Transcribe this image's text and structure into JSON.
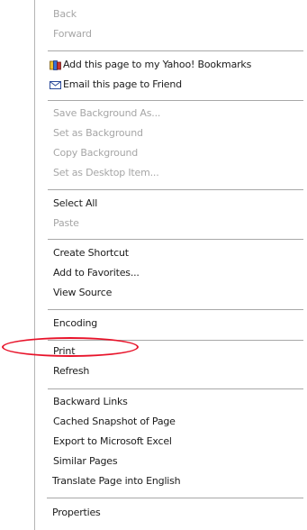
{
  "menu": {
    "items": [
      {
        "label": "Back",
        "disabled": true
      },
      {
        "label": "Forward",
        "disabled": true
      },
      {
        "label": "Add this page to my Yahoo! Bookmarks",
        "icon": "yahoo-bookmark-icon"
      },
      {
        "label": "Email this page to Friend",
        "icon": "envelope-icon"
      },
      {
        "label": "Save Background As...",
        "disabled": true
      },
      {
        "label": "Set as Background",
        "disabled": true
      },
      {
        "label": "Copy Background",
        "disabled": true
      },
      {
        "label": "Set as Desktop Item...",
        "disabled": true
      },
      {
        "label": "Select All"
      },
      {
        "label": "Paste",
        "disabled": true
      },
      {
        "label": "Create Shortcut"
      },
      {
        "label": "Add to Favorites..."
      },
      {
        "label": "View Source"
      },
      {
        "label": "Encoding",
        "submenu": true
      },
      {
        "label": "Print",
        "highlighted": true
      },
      {
        "label": "Refresh"
      },
      {
        "label": "Backward Links"
      },
      {
        "label": "Cached Snapshot of Page"
      },
      {
        "label": "Export to Microsoft Excel"
      },
      {
        "label": "Similar Pages"
      },
      {
        "label": "Translate Page into English"
      },
      {
        "label": "Properties"
      }
    ]
  },
  "colors": {
    "enabled_text": "#1c1c1c",
    "disabled_text": "#a6a6a6",
    "separator": "#a8a8a8",
    "highlight_circle": "#e8132a"
  }
}
